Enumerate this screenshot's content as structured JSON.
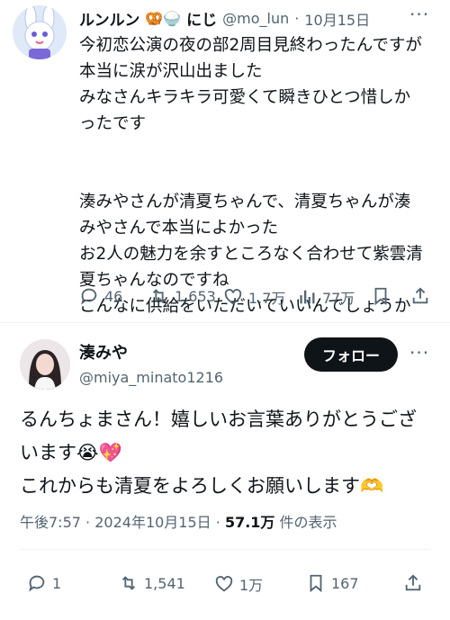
{
  "reply_tweet": {
    "display_name": "ルンルン",
    "name_emojis": "🥨🍚",
    "name_suffix": "にじ",
    "handle": "@mo_lun",
    "separator": "·",
    "date": "10月15日",
    "more_label": "···",
    "body_lines_1": [
      "今初恋公演の夜の部2周目見終わったんですが",
      "本当に涙が沢山出ました",
      "みなさんキラキラ可愛くて瞬きひとつ惜しか",
      "ったです"
    ],
    "body_lines_2": [
      "湊みやさんが清夏ちゃんで、清夏ちゃんが湊",
      "みやさんで本当によかった",
      "お2人の魅力を余すところなく合わせて紫雲清",
      "夏ちゃんなのですね",
      "こんなに供給をいただいていいんでしょうか"
    ],
    "actions": {
      "replies": "46",
      "retweets": "1,653",
      "likes": "1.7万",
      "views": "77万"
    }
  },
  "main_tweet": {
    "display_name": "湊みや",
    "handle": "@miya_minato1216",
    "follow_label": "フォロー",
    "more_label": "···",
    "body_line_1": "るんちょまさん！嬉しいお言葉ありがとうござ",
    "body_line_2_text": "います",
    "body_line_2_emojis": "😭💖",
    "body_line_3_text": "これからも清夏をよろしくお願いします",
    "body_line_3_emoji": "🫶",
    "time": "午後7:57",
    "meta_separator": "·",
    "date": "2024年10月15日",
    "view_count": "57.1万",
    "view_suffix": "件の表示",
    "actions": {
      "replies": "1",
      "retweets": "1,541",
      "likes": "1万",
      "bookmarks": "167"
    }
  }
}
